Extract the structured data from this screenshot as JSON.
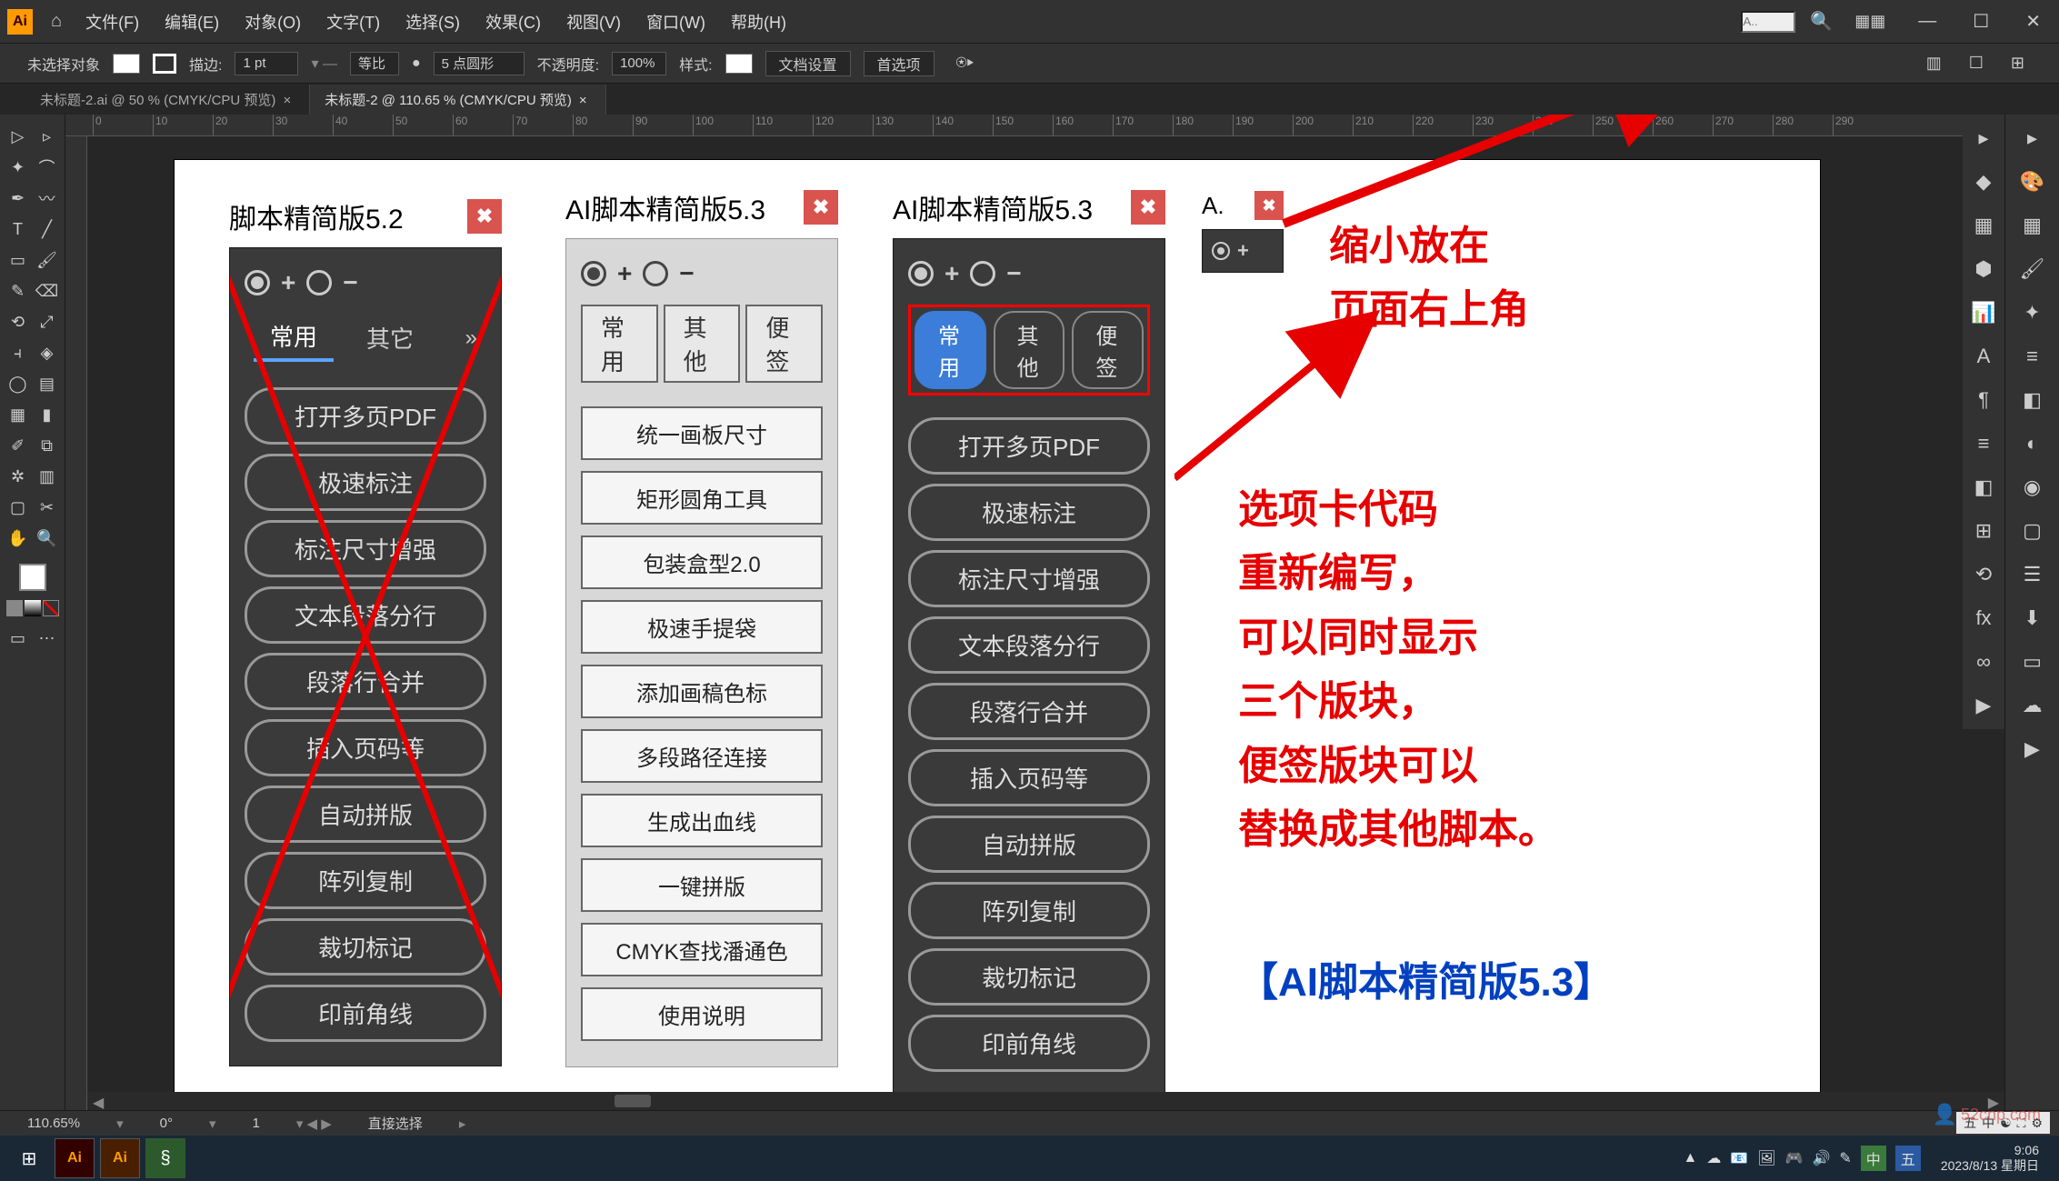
{
  "app": {
    "logo": "Ai"
  },
  "menu": [
    "文件(F)",
    "编辑(E)",
    "对象(O)",
    "文字(T)",
    "选择(S)",
    "效果(C)",
    "视图(V)",
    "窗口(W)",
    "帮助(H)"
  ],
  "top_search_placeholder": "A..",
  "options": {
    "no_selection": "未选择对象",
    "stroke_label": "描边:",
    "stroke_value": "1 pt",
    "uniform": "等比",
    "corner_value": "5 点圆形",
    "opacity_label": "不透明度:",
    "opacity_value": "100%",
    "style_label": "样式:",
    "doc_setup": "文档设置",
    "prefs": "首选项"
  },
  "doc_tabs": [
    {
      "label": "未标题-2.ai @ 50 % (CMYK/CPU 预览)",
      "active": false
    },
    {
      "label": "未标题-2 @ 110.65 % (CMYK/CPU 预览)",
      "active": true
    }
  ],
  "ruler_ticks": [
    "0",
    "10",
    "20",
    "30",
    "40",
    "50",
    "60",
    "70",
    "80",
    "90",
    "100",
    "110",
    "120",
    "130",
    "140",
    "150",
    "160",
    "170",
    "180",
    "190",
    "200",
    "210",
    "220",
    "230",
    "240",
    "250",
    "260",
    "270",
    "280",
    "290"
  ],
  "panel52": {
    "title": "脚本精简版5.2",
    "tabs": [
      "常用",
      "其它"
    ],
    "buttons": [
      "打开多页PDF",
      "极速标注",
      "标注尺寸增强",
      "文本段落分行",
      "段落行合并",
      "插入页码等",
      "自动拼版",
      "阵列复制",
      "裁切标记",
      "印前角线"
    ]
  },
  "panel53_light": {
    "title": "AI脚本精简版5.3",
    "tabs": [
      "常用",
      "其他",
      "便签"
    ],
    "buttons": [
      "统一画板尺寸",
      "矩形圆角工具",
      "包装盒型2.0",
      "极速手提袋",
      "添加画稿色标",
      "多段路径连接",
      "生成出血线",
      "一键拼版",
      "CMYK查找潘通色",
      "使用说明"
    ]
  },
  "panel53_dark": {
    "title": "AI脚本精简版5.3",
    "tabs": [
      "常用",
      "其他",
      "便签"
    ],
    "buttons": [
      "打开多页PDF",
      "极速标注",
      "标注尺寸增强",
      "文本段落分行",
      "段落行合并",
      "插入页码等",
      "自动拼版",
      "阵列复制",
      "裁切标记",
      "印前角线"
    ]
  },
  "panel_mini": {
    "title": "A."
  },
  "annotations": {
    "top": "缩小放在\n页面右上角",
    "mid": "选项卡代码\n重新编写，\n可以同时显示\n三个版块，\n便签版块可以\n替换成其他脚本。",
    "bottom": "【AI脚本精简版5.3】"
  },
  "status": {
    "zoom": "110.65%",
    "angle": "0°",
    "coord": "1",
    "tool": "直接选择"
  },
  "tray_strip": [
    "五",
    "中",
    "☯",
    "⛶",
    "⚙"
  ],
  "taskbar": {
    "tray": [
      "▲",
      "☁",
      "📧",
      "🖼",
      "🎮",
      "🔊",
      "✎",
      "中",
      "五"
    ],
    "time": "9:06",
    "date": "2023/8/13 星期日"
  },
  "watermark": "52cnp.com"
}
